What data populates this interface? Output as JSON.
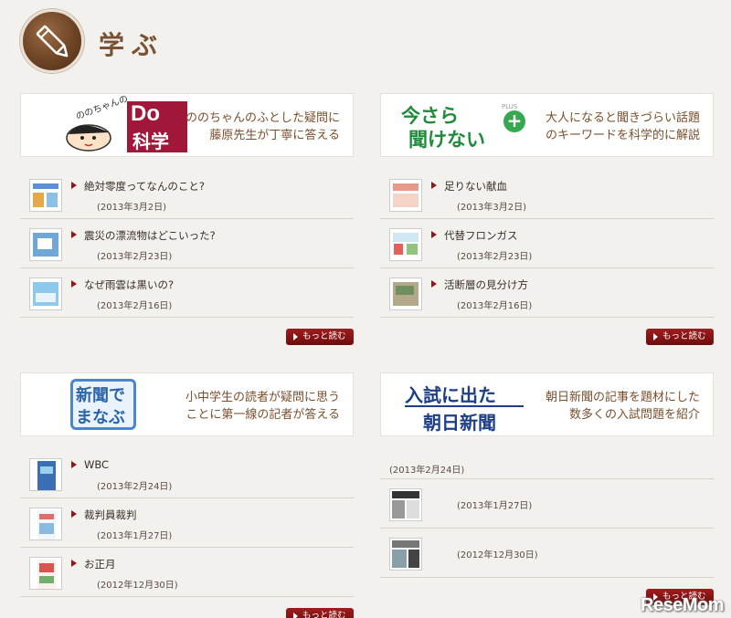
{
  "header": {
    "title": "学ぶ"
  },
  "cards": [
    {
      "id": "do_kagaku",
      "logo_text_main": "Do",
      "logo_text_sub": "科学",
      "logo_text_kana": "ののちゃんの",
      "description": "ののちゃんのふとした疑問に藤原先生が丁寧に答える",
      "desc_line1": "ののちゃんのふとした疑問に",
      "desc_line2": "藤原先生が丁寧に答える",
      "items": [
        {
          "title": "絶対零度ってなんのこと?",
          "date": "(2013年3月2日)"
        },
        {
          "title": "震災の漂流物はどこいった?",
          "date": "(2013年2月23日)"
        },
        {
          "title": "なぜ雨雲は黒いの?",
          "date": "(2013年2月16日)"
        }
      ],
      "more": "もっと読む"
    },
    {
      "id": "imasara",
      "logo_line1": "今さら",
      "logo_line2": "聞けない",
      "logo_plus": "PLUS",
      "desc_line1": "大人になると聞きづらい話題",
      "desc_line2": "のキーワードを科学的に解説",
      "items": [
        {
          "title": "足りない献血",
          "date": "(2013年3月2日)"
        },
        {
          "title": "代替フロンガス",
          "date": "(2013年2月23日)"
        },
        {
          "title": "活断層の見分け方",
          "date": "(2013年2月16日)"
        }
      ],
      "more": "もっと読む"
    },
    {
      "id": "shinbun",
      "logo_line1": "新聞で",
      "logo_line2": "まなぶ",
      "desc_line1": "小中学生の読者が疑問に思う",
      "desc_line2": "ことに第一線の記者が答える",
      "items": [
        {
          "title": "WBC",
          "date": "(2013年2月24日)"
        },
        {
          "title": "裁判員裁判",
          "date": "(2013年1月27日)"
        },
        {
          "title": "お正月",
          "date": "(2012年12月30日)"
        }
      ],
      "more": "もっと読む"
    },
    {
      "id": "nyushi",
      "logo_line1": "入試に出た",
      "logo_line2": "朝日新聞",
      "desc_line1": "朝日新聞の記事を題材にした",
      "desc_line2": "数多くの入試問題を紹介",
      "first_date": "(2013年2月24日)",
      "items": [
        {
          "date": "(2013年1月27日)"
        },
        {
          "date": "(2012年12月30日)"
        }
      ],
      "more": "もっと読む"
    }
  ],
  "watermark": "ReseMom"
}
